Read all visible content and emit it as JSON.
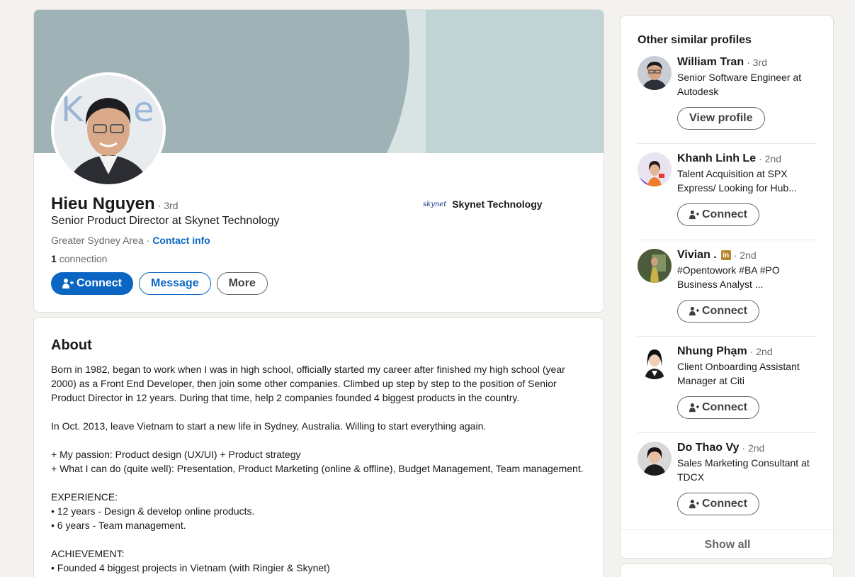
{
  "profile": {
    "name": "Hieu Nguyen",
    "degree": "· 3rd",
    "headline": "Senior Product Director at Skynet Technology",
    "location": "Greater Sydney Area ·",
    "contact_info": "Contact info",
    "connections_count": "1",
    "connections_label": "connection",
    "company_logo_text": "skynet",
    "company_name": "Skynet Technology",
    "actions": {
      "connect": "Connect",
      "message": "Message",
      "more": "More"
    }
  },
  "about": {
    "title": "About",
    "text": "Born in 1982, began to work when I was in high school, officially started my career after finished my high school (year 2000) as a Front End Developer, then join some other companies. Climbed up step by step to the position of Senior Product Director in 12 years. During that time, help 2 companies founded 4 biggest products in the country.\n\nIn Oct. 2013, leave Vietnam to start a new life in Sydney, Australia. Willing to start everything again.\n\n+ My passion: Product design (UX/UI) + Product strategy\n+ What I can do (quite well): Presentation, Product Marketing (online & offline), Budget Management, Team management.\n\nEXPERIENCE:\n• 12 years - Design & develop online products.\n• 6 years - Team management.\n\nACHIEVEMENT:\n• Founded 4 biggest projects in Vietnam (with Ringier & Skynet)"
  },
  "sidebar": {
    "title": "Other similar profiles",
    "show_all": "Show all",
    "people": [
      {
        "name": "William Tran",
        "degree": "· 3rd",
        "headline": "Senior Software Engineer at Autodesk",
        "button": "View profile"
      },
      {
        "name": "Khanh Linh Le",
        "degree": "· 2nd",
        "headline": "Talent Acquisition at SPX Express/ Looking for Hub...",
        "button": "Connect"
      },
      {
        "name": "Vivian .",
        "degree": "· 2nd",
        "headline": "#Opentowork #BA #PO Business Analyst ...",
        "button": "Connect",
        "badge": "in"
      },
      {
        "name": "Nhung Phạm",
        "degree": "· 2nd",
        "headline": "Client Onboarding Assistant Manager at Citi",
        "button": "Connect"
      },
      {
        "name": "Do Thao Vy",
        "degree": "· 2nd",
        "headline": "Sales Marketing Consultant at TDCX",
        "button": "Connect"
      }
    ]
  },
  "colors": {
    "brand_blue": "#0a66c2",
    "page_bg": "#f4f2ee",
    "banner_dark": "#9fb2b5",
    "banner_light": "#c0d3d5"
  }
}
